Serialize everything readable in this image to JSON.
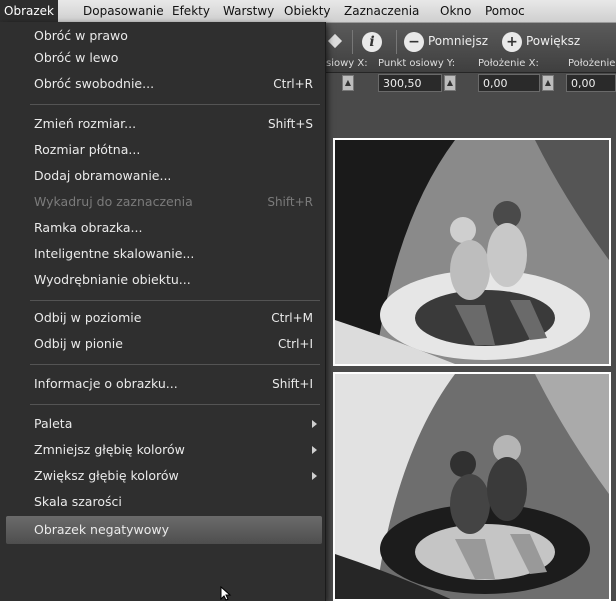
{
  "menubar": [
    {
      "label": "Obrazek",
      "active": true
    },
    {
      "label": "Dopasowanie"
    },
    {
      "label": "Efekty"
    },
    {
      "label": "Warstwy"
    },
    {
      "label": "Obiekty"
    },
    {
      "label": "Zaznaczenia"
    },
    {
      "label": "Okno"
    },
    {
      "label": "Pomoc"
    }
  ],
  "toolbar": {
    "zoom_out_label": "Pomniejsz",
    "zoom_in_label": "Powiększ",
    "info_icon": "info-icon",
    "zoom_out_icon": "zoom-out-icon",
    "zoom_in_icon": "zoom-in-icon"
  },
  "properties": {
    "pivot_x_label": "siowy X:",
    "pivot_y_label": "Punkt osiowy Y:",
    "pivot_y_value": "300,50",
    "pos_x_label": "Położenie X:",
    "pos_x_value": "0,00",
    "pos_y_label": "Położenie",
    "pos_y_value": "0,00"
  },
  "menu": {
    "items": [
      {
        "label": "Obróć w prawo",
        "shortcut": ""
      },
      {
        "label": "Obróć w lewo",
        "shortcut": ""
      },
      {
        "label": "Obróć swobodnie...",
        "shortcut": "Ctrl+R"
      },
      {
        "label": "Zmień rozmiar...",
        "shortcut": "Shift+S"
      },
      {
        "label": "Rozmiar płótna...",
        "shortcut": ""
      },
      {
        "label": "Dodaj obramowanie...",
        "shortcut": ""
      },
      {
        "label": "Wykadruj do zaznaczenia",
        "shortcut": "Shift+R",
        "disabled": true
      },
      {
        "label": "Ramka obrazka...",
        "shortcut": ""
      },
      {
        "label": "Inteligentne skalowanie...",
        "shortcut": ""
      },
      {
        "label": "Wyodrębnianie obiektu...",
        "shortcut": ""
      },
      {
        "label": "Odbij w poziomie",
        "shortcut": "Ctrl+M"
      },
      {
        "label": "Odbij w pionie",
        "shortcut": "Ctrl+I"
      },
      {
        "label": "Informacje o obrazku...",
        "shortcut": "Shift+I"
      },
      {
        "label": "Paleta",
        "shortcut": "",
        "submenu": true
      },
      {
        "label": "Zmniejsz głębię kolorów",
        "shortcut": "",
        "submenu": true
      },
      {
        "label": "Zwiększ głębię kolorów",
        "shortcut": "",
        "submenu": true
      },
      {
        "label": "Skala szarości",
        "shortcut": ""
      },
      {
        "label": "Obrazek negatywowy",
        "shortcut": "",
        "highlighted": true
      }
    ]
  },
  "colors": {
    "menu_bg": "#2f2f2f",
    "highlight": "#5c5c5c",
    "disabled_text": "#7b7b7b"
  }
}
